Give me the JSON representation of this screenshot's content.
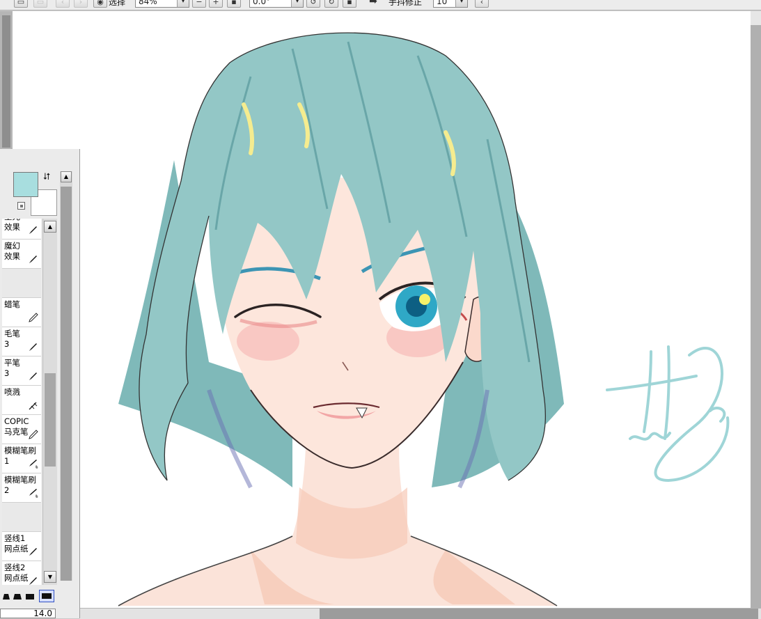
{
  "toolbar": {
    "select_label": "选择",
    "zoom_value": "84%",
    "angle_value": "0.0°",
    "stabilizer_label": "手抖修正",
    "stabilizer_value": "10"
  },
  "color_panel": {
    "foreground_color": "#a8dedf",
    "background_color": "#ffffff"
  },
  "brush_list": {
    "items": [
      {
        "label": "星光\n效果",
        "icon": "pen-icon"
      },
      {
        "label": "魔幻\n效果",
        "icon": "pen-icon"
      },
      {
        "label": "",
        "icon": ""
      },
      {
        "label": "蜡笔",
        "icon": "pencil-icon"
      },
      {
        "label": "毛笔\n3",
        "icon": "pen-icon"
      },
      {
        "label": "平笔\n3",
        "icon": "pen-icon"
      },
      {
        "label": "喷溅",
        "icon": "airbrush-icon"
      },
      {
        "label": "COPIC\n马克笔",
        "icon": "pencil-icon"
      },
      {
        "label": "模糊笔刷\n1",
        "icon": "blur-brush-icon"
      },
      {
        "label": "模糊笔刷\n2",
        "icon": "blur-brush-icon"
      },
      {
        "label": "",
        "icon": ""
      },
      {
        "label": "竖线1\n网点纸",
        "icon": "pen-icon"
      },
      {
        "label": "竖线2\n网点纸",
        "icon": "pen-icon"
      }
    ]
  },
  "brush_size": "14.0"
}
